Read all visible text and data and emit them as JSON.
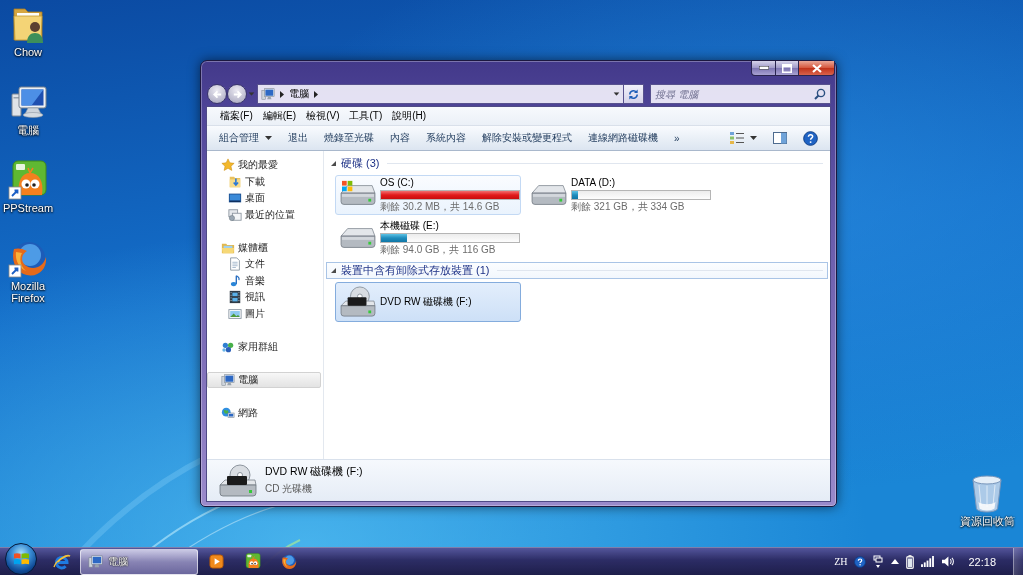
{
  "desktop": {
    "icons": [
      {
        "label": "Chow",
        "kind": "user-folder",
        "shortcut": false
      },
      {
        "label": "電腦",
        "kind": "computer",
        "shortcut": false
      },
      {
        "label": "PPStream",
        "kind": "pps",
        "shortcut": true
      },
      {
        "label": "Mozilla Firefox",
        "kind": "firefox",
        "shortcut": true
      }
    ],
    "recycle_bin": {
      "label": "資源回收筒"
    }
  },
  "window": {
    "navigation": {
      "back": {
        "disabled": true
      },
      "forward": {
        "disabled": true
      }
    },
    "address": {
      "breadcrumb": [
        "電腦"
      ]
    },
    "search": {
      "placeholder": "搜尋 電腦"
    },
    "menu": [
      "檔案(F)",
      "編輯(E)",
      "檢視(V)",
      "工具(T)",
      "說明(H)"
    ],
    "toolbar": {
      "items": [
        {
          "label": "組合管理",
          "dropdown": true
        },
        {
          "label": "退出",
          "dropdown": false
        },
        {
          "label": "燒錄至光碟",
          "dropdown": false
        },
        {
          "label": "內容",
          "dropdown": false
        },
        {
          "label": "系統內容",
          "dropdown": false
        },
        {
          "label": "解除安裝或變更程式",
          "dropdown": false
        },
        {
          "label": "連線網路磁碟機",
          "dropdown": false
        }
      ],
      "more": "»"
    },
    "sidebar": {
      "items": [
        {
          "label": "我的最愛",
          "kind": "favorites",
          "selected": false,
          "children": [
            {
              "label": "下載",
              "kind": "downloads",
              "selected": false
            },
            {
              "label": "桌面",
              "kind": "desktop",
              "selected": false
            },
            {
              "label": "最近的位置",
              "kind": "recent",
              "selected": false
            }
          ]
        },
        {
          "label": "媒體櫃",
          "kind": "libraries",
          "selected": false,
          "children": [
            {
              "label": "文件",
              "kind": "documents",
              "selected": false
            },
            {
              "label": "音樂",
              "kind": "music",
              "selected": false
            },
            {
              "label": "視訊",
              "kind": "videos",
              "selected": false
            },
            {
              "label": "圖片",
              "kind": "pictures",
              "selected": false
            }
          ]
        },
        {
          "label": "家用群組",
          "kind": "homegroup",
          "selected": false
        },
        {
          "label": "電腦",
          "kind": "computer",
          "selected": true
        },
        {
          "label": "網路",
          "kind": "network",
          "selected": false
        }
      ]
    },
    "content": {
      "groups": [
        {
          "title": "硬碟 (3)",
          "expanded": true,
          "focused": false,
          "drives": [
            {
              "name": "OS (C:)",
              "kind": "system-disk",
              "level": 0.998,
              "low_space": true,
              "free": "剩餘 30.2 MB，共 14.6 GB",
              "hovered": true,
              "selected": false
            },
            {
              "name": "DATA (D:)",
              "kind": "disk",
              "level": 0.04,
              "low_space": false,
              "free": "剩餘 321 GB，共 334 GB",
              "hovered": false,
              "selected": false
            },
            {
              "name": "本機磁碟 (E:)",
              "kind": "disk",
              "level": 0.19,
              "low_space": false,
              "free": "剩餘 94.0 GB，共 116 GB",
              "hovered": false,
              "selected": false
            }
          ]
        },
        {
          "title": "裝置中含有卸除式存放裝置 (1)",
          "expanded": true,
          "focused": true,
          "drives": [
            {
              "name": "DVD RW 磁碟機 (F:)",
              "kind": "optical",
              "hovered": false,
              "selected": true
            }
          ]
        }
      ]
    },
    "details": {
      "kind": "optical",
      "name": "DVD RW 磁碟機 (F:)",
      "type": "CD 光碟機"
    }
  },
  "taskbar": {
    "buttons": [
      {
        "kind": "browser-e",
        "active": false
      },
      {
        "kind": "explorer",
        "label": "電腦",
        "active": true
      },
      {
        "kind": "media-player",
        "active": false
      },
      {
        "kind": "pps",
        "active": false
      },
      {
        "kind": "firefox",
        "active": false
      }
    ],
    "tray": {
      "language": "ZH",
      "time": "22:18"
    }
  }
}
